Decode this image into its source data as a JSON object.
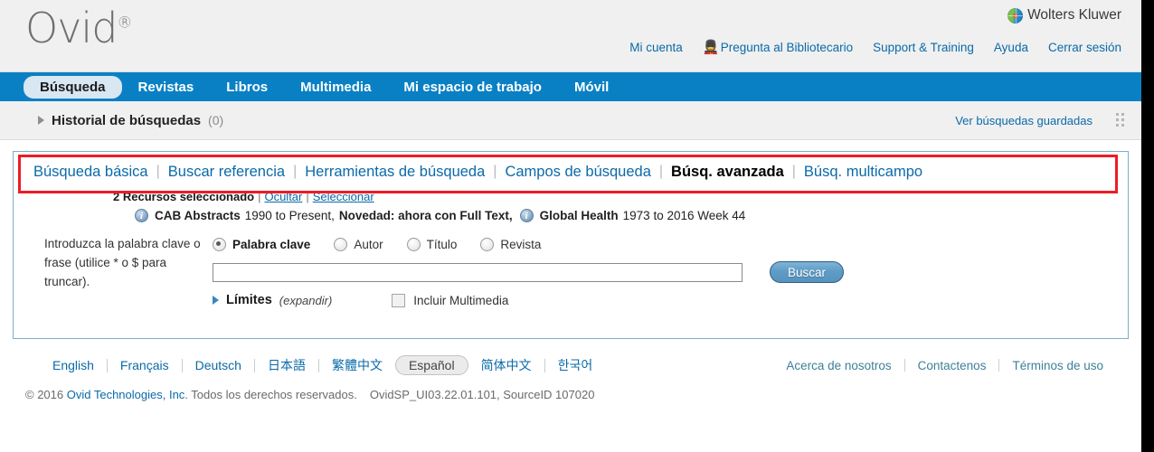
{
  "header": {
    "logo_text": "Ovid",
    "logo_registered": "®",
    "brand": "Wolters Kluwer",
    "brand_icon": "globe-icon",
    "links": [
      {
        "label": "Mi cuenta",
        "icon": null
      },
      {
        "label": "Pregunta al Bibliotecario",
        "icon": "librarian-icon"
      },
      {
        "label": "Support & Training",
        "icon": null
      },
      {
        "label": "Ayuda",
        "icon": null
      },
      {
        "label": "Cerrar sesión",
        "icon": null
      }
    ]
  },
  "nav": {
    "items": [
      {
        "label": "Búsqueda",
        "active": true
      },
      {
        "label": "Revistas",
        "active": false
      },
      {
        "label": "Libros",
        "active": false
      },
      {
        "label": "Multimedia",
        "active": false
      },
      {
        "label": "Mi espacio de trabajo",
        "active": false
      },
      {
        "label": "Móvil",
        "active": false
      }
    ]
  },
  "history": {
    "expand_icon": "triangle-right-icon",
    "title": "Historial de búsquedas",
    "count": "(0)",
    "saved_searches_label": "Ver búsquedas guardadas",
    "grip_icon": "grip-dots-icon"
  },
  "search_tabs": {
    "items": [
      {
        "label": "Búsqueda básica",
        "active": false
      },
      {
        "label": "Buscar referencia",
        "active": false
      },
      {
        "label": "Herramientas de búsqueda",
        "active": false
      },
      {
        "label": "Campos de búsqueda",
        "active": false
      },
      {
        "label": "Búsq. avanzada",
        "active": true
      },
      {
        "label": "Búsq. multicampo",
        "active": false
      }
    ],
    "separator": "|",
    "highlight_color": "#ee1c25"
  },
  "resources": {
    "selected_text": "2 Recursos seleccionado",
    "hide_label": "Ocultar",
    "select_label": "Seleccionar",
    "separator": "|",
    "databases": [
      {
        "icon": "info-icon",
        "name": "CAB Abstracts",
        "range": "1990 to Present,",
        "note": "Novedad: ahora con Full Text,"
      },
      {
        "icon": "info-icon",
        "name": "Global Health",
        "range": "1973 to 2016 Week 44",
        "note": ""
      }
    ]
  },
  "form": {
    "prompt": "Introduzca la palabra clave o frase (utilice * o $ para truncar).",
    "radios": [
      {
        "label": "Palabra clave",
        "checked": true
      },
      {
        "label": "Autor",
        "checked": false
      },
      {
        "label": "Título",
        "checked": false
      },
      {
        "label": "Revista",
        "checked": false
      }
    ],
    "search_value": "",
    "search_placeholder": "",
    "submit_label": "Buscar",
    "limits_label": "Límites",
    "limits_expand": "(expandir)",
    "limits_icon": "triangle-right-icon",
    "multimedia_label": "Incluir Multimedia",
    "multimedia_checked": false
  },
  "footer": {
    "languages": [
      {
        "label": "English",
        "selected": false
      },
      {
        "label": "Français",
        "selected": false
      },
      {
        "label": "Deutsch",
        "selected": false
      },
      {
        "label": "日本語",
        "selected": false
      },
      {
        "label": "繁體中文",
        "selected": false
      },
      {
        "label": "Español",
        "selected": true
      },
      {
        "label": "简体中文",
        "selected": false
      },
      {
        "label": "한국어",
        "selected": false
      }
    ],
    "links": [
      {
        "label": "Acerca de nosotros"
      },
      {
        "label": "Contactenos"
      },
      {
        "label": "Términos de uso"
      }
    ],
    "copyright_prefix": "© 2016 ",
    "copyright_company": "Ovid Technologies, Inc",
    "copyright_suffix": ". Todos los derechos reservados.",
    "version": "OvidSP_UI03.22.01.101, SourceID 107020"
  }
}
